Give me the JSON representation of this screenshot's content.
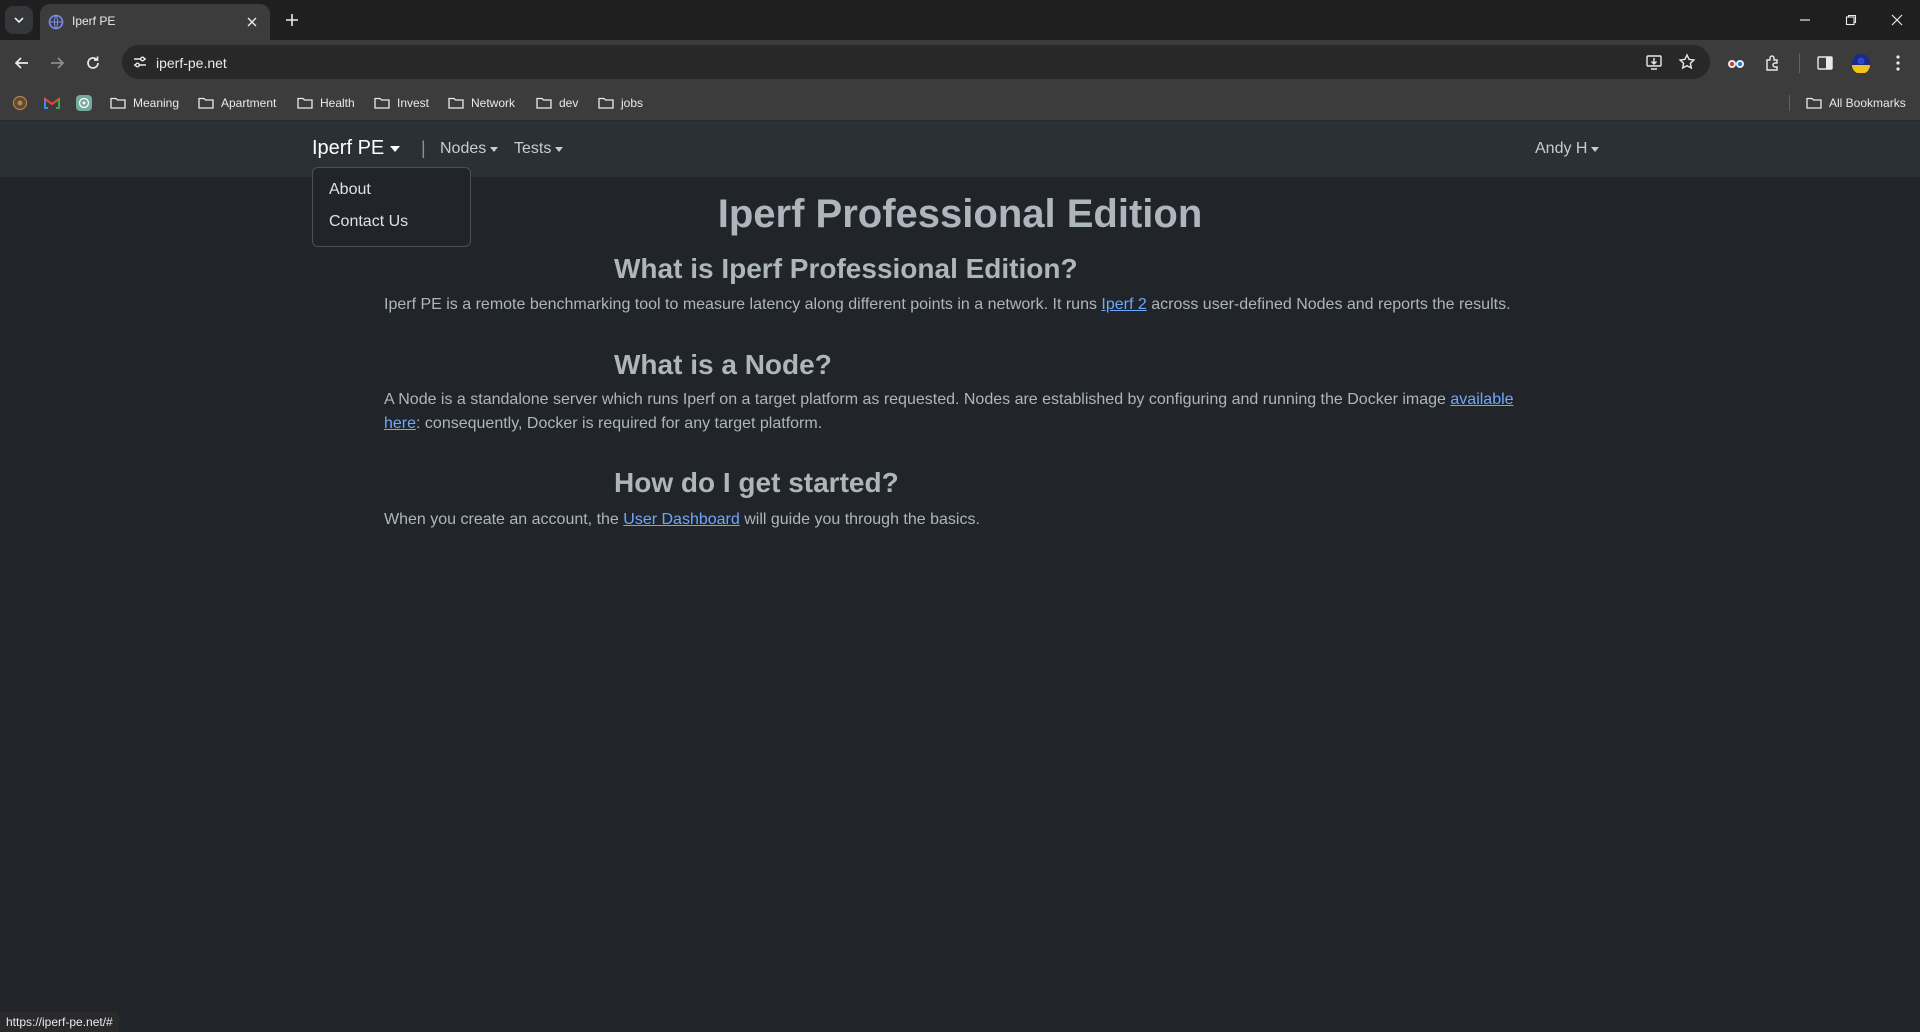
{
  "browser": {
    "tab_title": "Iperf PE",
    "url": "iperf-pe.net",
    "status_url": "https://iperf-pe.net/#",
    "bookmarks": [
      "Meaning",
      "Apartment",
      "Health",
      "Invest",
      "Network",
      "dev",
      "jobs"
    ],
    "all_bookmarks": "All Bookmarks"
  },
  "navbar": {
    "brand": "Iperf PE",
    "divider": "|",
    "nodes": "Nodes",
    "tests": "Tests",
    "user": "Andy H"
  },
  "dropdown": {
    "about": "About",
    "contact": "Contact Us"
  },
  "content": {
    "title": "Iperf Professional Edition",
    "sections": [
      {
        "heading": "What is Iperf Professional Edition?",
        "p_before": "Iperf PE is a remote benchmarking tool to measure latency along different points in a network. It runs ",
        "link": "Iperf 2",
        "p_after": " across user-defined Nodes and reports the results."
      },
      {
        "heading": "What is a Node?",
        "p_before": "A Node is a standalone server which runs Iperf on a target platform as requested. Nodes are established by configuring and running the Docker image ",
        "link": "available here",
        "p_after": ": consequently, Docker is required for any target platform."
      },
      {
        "heading": "How do I get started?",
        "p_before": "When you create an account, the ",
        "link": "User Dashboard",
        "p_after": " will guide you through the basics."
      }
    ]
  },
  "icons": {
    "tab_favicon": "globe-icon",
    "gmail": "gmail-icon",
    "chatgpt": "chatgpt-icon"
  },
  "colors": {
    "page_bg": "#212529",
    "navbar_bg": "#2b3035",
    "text": "#adb5bd",
    "link": "#6ea8fe"
  }
}
